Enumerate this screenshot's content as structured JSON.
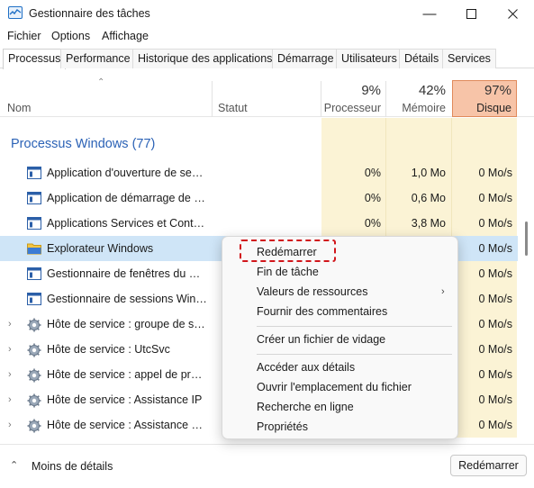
{
  "window": {
    "title": "Gestionnaire des tâches"
  },
  "menu": [
    "Fichier",
    "Options",
    "Affichage"
  ],
  "tabs": [
    "Processus",
    "Performance",
    "Historique des applications",
    "Démarrage",
    "Utilisateurs",
    "Détails",
    "Services"
  ],
  "header": {
    "name": "Nom",
    "status": "Statut",
    "cpu_pct": "9%",
    "cpu_label": "Processeur",
    "mem_pct": "42%",
    "mem_label": "Mémoire",
    "disk_pct": "97%",
    "disk_label": "Disque"
  },
  "group": {
    "title": "Processus Windows (77)"
  },
  "rows": [
    {
      "name": "Application d'ouverture de sessi...",
      "cpu": "0%",
      "mem": "1,0 Mo",
      "disk": "0 Mo/s",
      "icon": "window-icon"
    },
    {
      "name": "Application de démarrage de W...",
      "cpu": "0%",
      "mem": "0,6 Mo",
      "disk": "0 Mo/s",
      "icon": "window-icon"
    },
    {
      "name": "Applications Services et Contrôl...",
      "cpu": "0%",
      "mem": "3,8 Mo",
      "disk": "0 Mo/s",
      "icon": "window-icon"
    },
    {
      "name": "Explorateur Windows",
      "cpu": "",
      "mem": "",
      "disk": "0 Mo/s",
      "icon": "folder-icon"
    },
    {
      "name": "Gestionnaire de fenêtres du Bur...",
      "cpu": "",
      "mem": "",
      "disk": "0 Mo/s",
      "icon": "window-icon"
    },
    {
      "name": "Gestionnaire de sessions Windo...",
      "cpu": "",
      "mem": "",
      "disk": "0 Mo/s",
      "icon": "window-icon"
    },
    {
      "name": "Hôte de service : groupe de serv...",
      "cpu": "",
      "mem": "",
      "disk": "0 Mo/s",
      "icon": "gear-icon"
    },
    {
      "name": "Hôte de service : UtcSvc",
      "cpu": "",
      "mem": "",
      "disk": "0 Mo/s",
      "icon": "gear-icon"
    },
    {
      "name": "Hôte de service : appel de procé...",
      "cpu": "",
      "mem": "",
      "disk": "0 Mo/s",
      "icon": "gear-icon"
    },
    {
      "name": "Hôte de service : Assistance IP",
      "cpu": "",
      "mem": "",
      "disk": "0 Mo/s",
      "icon": "gear-icon"
    },
    {
      "name": "Hôte de service : Assistance Net...",
      "cpu": "",
      "mem": "",
      "disk": "0 Mo/s",
      "icon": "gear-icon"
    }
  ],
  "context_menu": {
    "restart": "Redémarrer",
    "end_task": "Fin de tâche",
    "resource_values": "Valeurs de ressources",
    "feedback": "Fournir des commentaires",
    "dump": "Créer un fichier de vidage",
    "details": "Accéder aux détails",
    "open_location": "Ouvrir l'emplacement du fichier",
    "search_online": "Recherche en ligne",
    "properties": "Propriétés"
  },
  "footer": {
    "less_details": "Moins de détails",
    "restart_button": "Redémarrer"
  },
  "colors": {
    "accent": "#2b62b6",
    "disk_highlight": "#f7c4a8",
    "usage_band": "#fbf3d5",
    "selection": "#cfe5f7",
    "callout": "#d1161b"
  }
}
